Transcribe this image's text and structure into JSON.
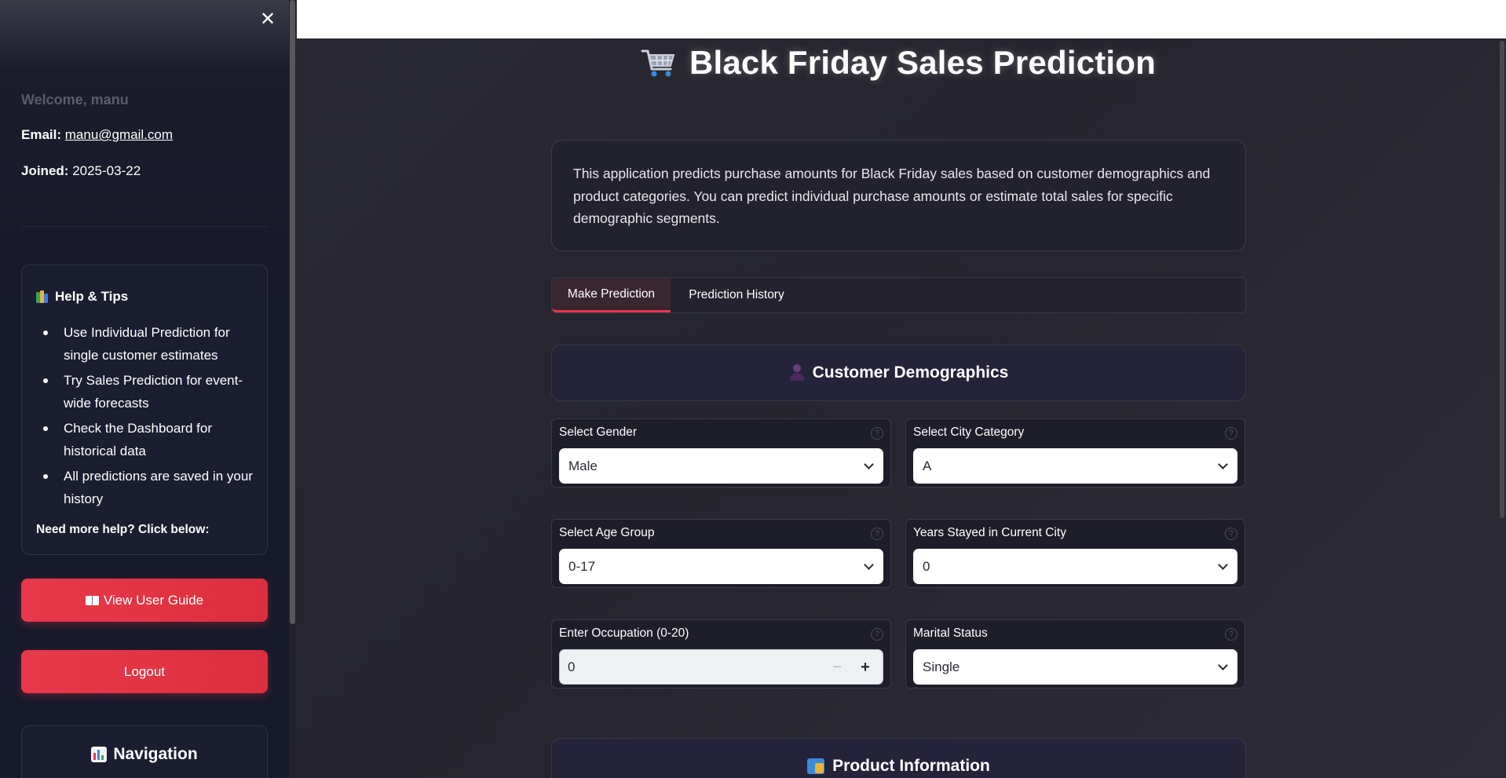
{
  "sidebar": {
    "welcome": "Welcome, manu",
    "email_label": "Email:",
    "email_value": "manu@gmail.com",
    "joined_label": "Joined:",
    "joined_value": "2025-03-22",
    "help": {
      "title": "Help & Tips",
      "items": [
        "Use Individual Prediction for single customer estimates",
        "Try Sales Prediction for event-wide forecasts",
        "Check the Dashboard for historical data",
        "All predictions are saved in your history"
      ],
      "more": "Need more help? Click below:"
    },
    "guide_button": "View User Guide",
    "logout_button": "Logout",
    "navigation_title": "Navigation"
  },
  "main": {
    "title": "Black Friday Sales Prediction",
    "info": "This application predicts purchase amounts for Black Friday sales based on customer demographics and product categories. You can predict individual purchase amounts or estimate total sales for specific demographic segments.",
    "tabs": [
      {
        "label": "Make Prediction",
        "active": true
      },
      {
        "label": "Prediction History",
        "active": false
      }
    ],
    "demographics_title": "Customer Demographics",
    "fields": {
      "gender": {
        "label": "Select Gender",
        "value": "Male"
      },
      "city": {
        "label": "Select City Category",
        "value": "A"
      },
      "age": {
        "label": "Select Age Group",
        "value": "0-17"
      },
      "years": {
        "label": "Years Stayed in Current City",
        "value": "0"
      },
      "occupation": {
        "label": "Enter Occupation (0-20)",
        "value": "0"
      },
      "marital": {
        "label": "Marital Status",
        "value": "Single"
      }
    },
    "product_title": "Product Information"
  },
  "colors": {
    "accent": "#e8394a",
    "sidebar_bg": "#171a2b",
    "main_bg": "#28272f"
  }
}
